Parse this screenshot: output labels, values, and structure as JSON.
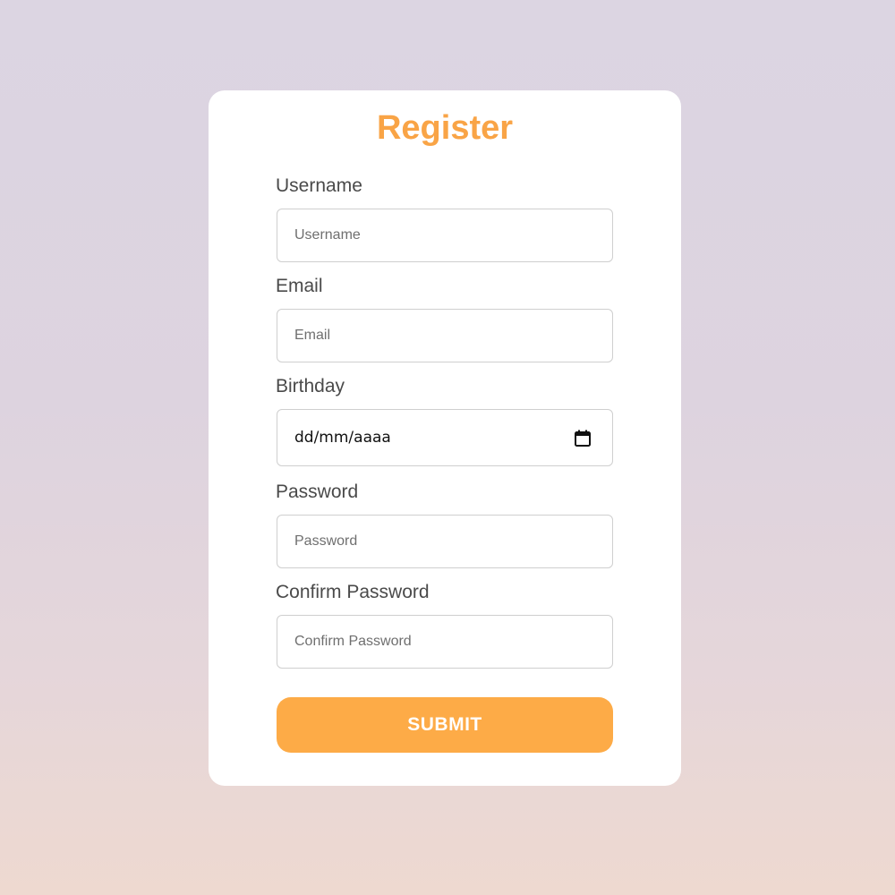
{
  "colors": {
    "accent": "#fdab47",
    "title": "#f9a446",
    "label": "#4a4a4a",
    "card_background": "#ffffff"
  },
  "form": {
    "title": "Register",
    "username": {
      "label": "Username",
      "placeholder": "Username",
      "value": ""
    },
    "email": {
      "label": "Email",
      "placeholder": "Email",
      "value": ""
    },
    "birthday": {
      "label": "Birthday",
      "display": "dd/mm/aaaa",
      "icon": "calendar-icon"
    },
    "password": {
      "label": "Password",
      "placeholder": "Password",
      "value": ""
    },
    "confirm_password": {
      "label": "Confirm Password",
      "placeholder": "Confirm Password",
      "value": ""
    },
    "submit_label": "SUBMIT"
  }
}
